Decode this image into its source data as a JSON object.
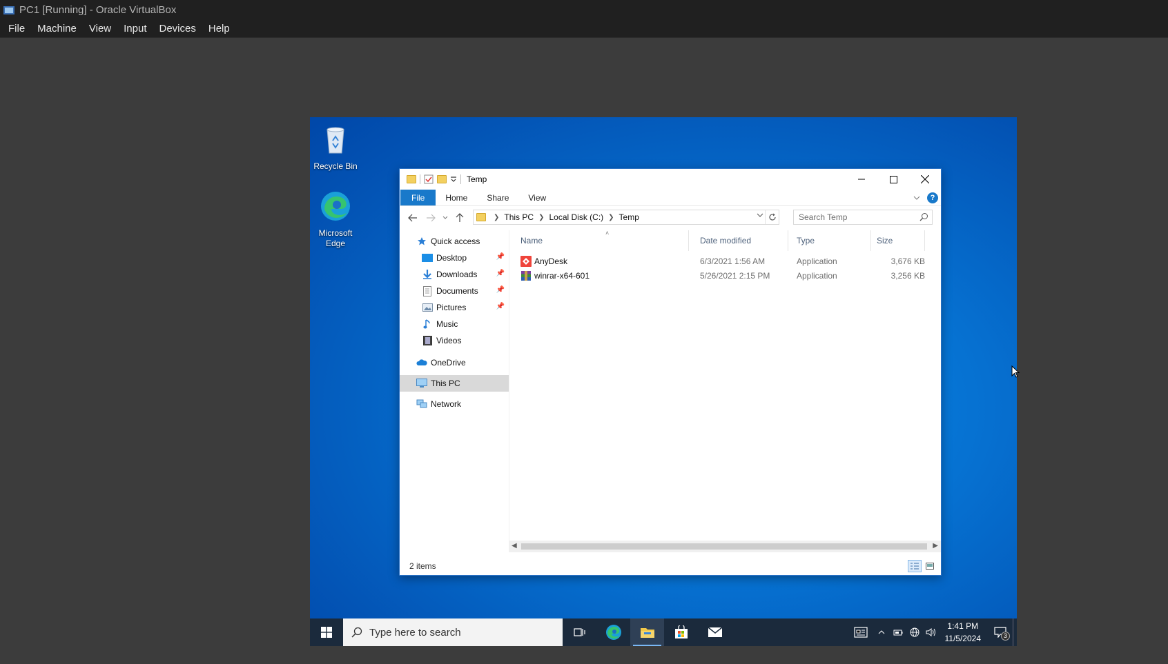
{
  "vbox": {
    "title": "PC1 [Running] - Oracle VirtualBox",
    "menu": [
      "File",
      "Machine",
      "View",
      "Input",
      "Devices",
      "Help"
    ]
  },
  "desktop": {
    "icons": [
      {
        "label": "Recycle Bin",
        "icon": "recycle-bin-icon"
      },
      {
        "label": "Microsoft Edge",
        "icon": "edge-icon"
      }
    ]
  },
  "explorer": {
    "title": "Temp",
    "ribbon_tabs": [
      "File",
      "Home",
      "Share",
      "View"
    ],
    "breadcrumb": [
      "This PC",
      "Local Disk (C:)",
      "Temp"
    ],
    "search_placeholder": "Search Temp",
    "nav": {
      "quick_access": "Quick access",
      "quick_items": [
        "Desktop",
        "Downloads",
        "Documents",
        "Pictures",
        "Music",
        "Videos"
      ],
      "onedrive": "OneDrive",
      "this_pc": "This PC",
      "network": "Network"
    },
    "columns": [
      "Name",
      "Date modified",
      "Type",
      "Size"
    ],
    "files": [
      {
        "name": "AnyDesk",
        "date": "6/3/2021 1:56 AM",
        "type": "Application",
        "size": "3,676 KB",
        "icon": "anydesk-icon"
      },
      {
        "name": "winrar-x64-601",
        "date": "5/26/2021 2:15 PM",
        "type": "Application",
        "size": "3,256 KB",
        "icon": "winrar-icon"
      }
    ],
    "status": "2 items"
  },
  "taskbar": {
    "search_placeholder": "Type here to search",
    "time": "1:41 PM",
    "date": "11/5/2024",
    "notification_count": "3"
  },
  "colors": {
    "accent": "#1979ca",
    "desktop_blue": "#0672d2",
    "vbox_bg": "#3c3c3c"
  }
}
